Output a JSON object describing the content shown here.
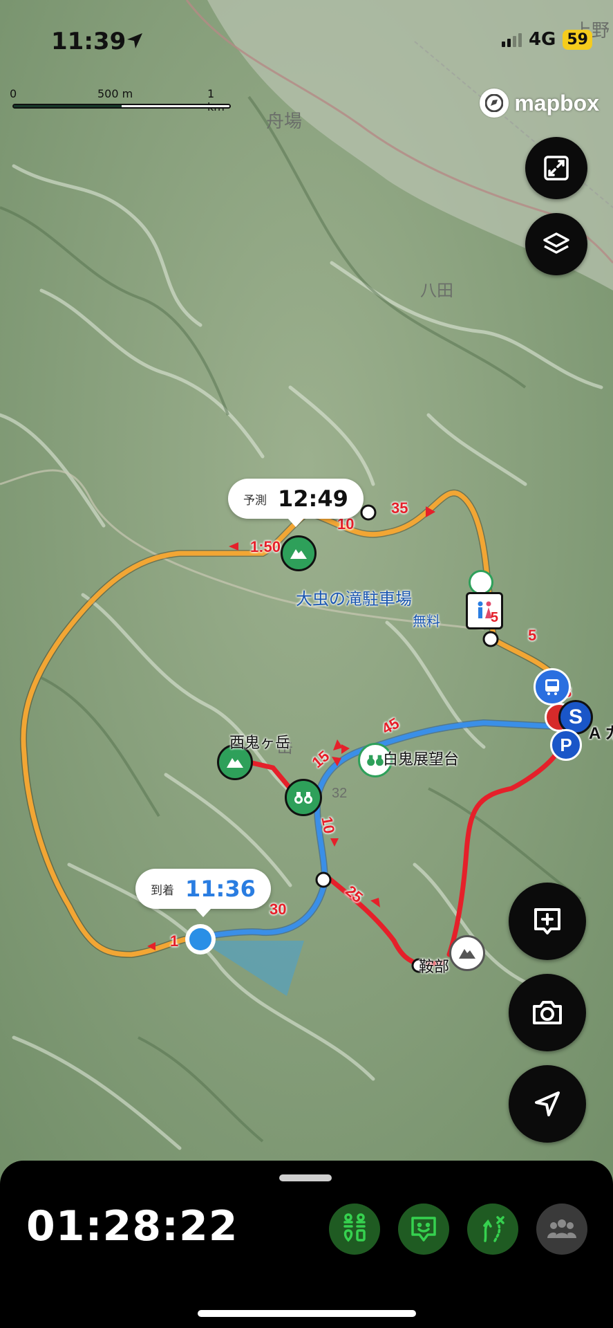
{
  "status_bar": {
    "time": "11:39",
    "network": "4G",
    "battery": "59"
  },
  "map": {
    "scale": {
      "label_0": "0",
      "label_mid": "500 m",
      "label_end": "1 km"
    },
    "attribution": "mapbox",
    "place_names": {
      "funaba": "舟場",
      "hatta": "八田",
      "kamino": "上野",
      "ka": "岳",
      "num32": "32"
    },
    "poi": {
      "parking_name": "大虫の滝駐車場",
      "parking_fee": "無料",
      "nishioni": "西鬼ヶ岳",
      "shiraoni": "白鬼展望台",
      "kurabe": "鞍部",
      "toilet_count": "5",
      "edge_label": "A カ"
    },
    "route_labels": {
      "t_35": "35",
      "t_10a": "10",
      "t_150": "1:50",
      "t_5": "5",
      "t_3": "3",
      "t_45": "45",
      "t_15": "15",
      "t_10b": "10",
      "t_25": "25",
      "t_30": "30",
      "t_1": "1"
    },
    "callout_forecast": {
      "label": "予測",
      "value": "12:49"
    },
    "callout_arrival": {
      "label": "到着",
      "value": "11:36"
    }
  },
  "bottom_sheet": {
    "elapsed_time": "01:28:22"
  },
  "colors": {
    "route_orange": "#f2a634",
    "route_red": "#e5202a",
    "route_blue": "#3a8fe8",
    "poi_green": "#2ea05a",
    "accent_green": "#2fb648",
    "sheet_bg": "#000000"
  },
  "icons": {
    "fullscreen": "expand-icon",
    "layers": "layers-icon",
    "add_note": "add-note-icon",
    "camera": "camera-icon",
    "locate": "location-arrow-icon",
    "tool1": "hikers-pin-icon",
    "tool2": "face-speech-icon",
    "tool3": "route-split-icon",
    "tool4": "group-icon"
  }
}
